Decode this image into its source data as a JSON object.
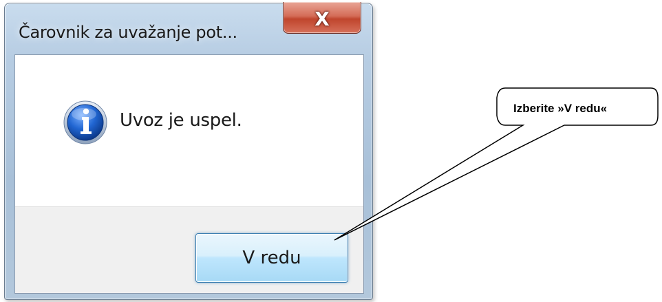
{
  "dialog": {
    "title": "Čarovnik za uvažanje pot...",
    "close_glyph": "X",
    "message": "Uvoz je uspel.",
    "ok_label": "V redu",
    "icon": "information-icon"
  },
  "callout": {
    "text": "Izberite »V redu«"
  },
  "colors": {
    "close_button": "#c0452d",
    "ok_button_border": "#3c7fb1",
    "info_icon": "#1f5fbf",
    "footer_bg": "#f0f0f0"
  }
}
